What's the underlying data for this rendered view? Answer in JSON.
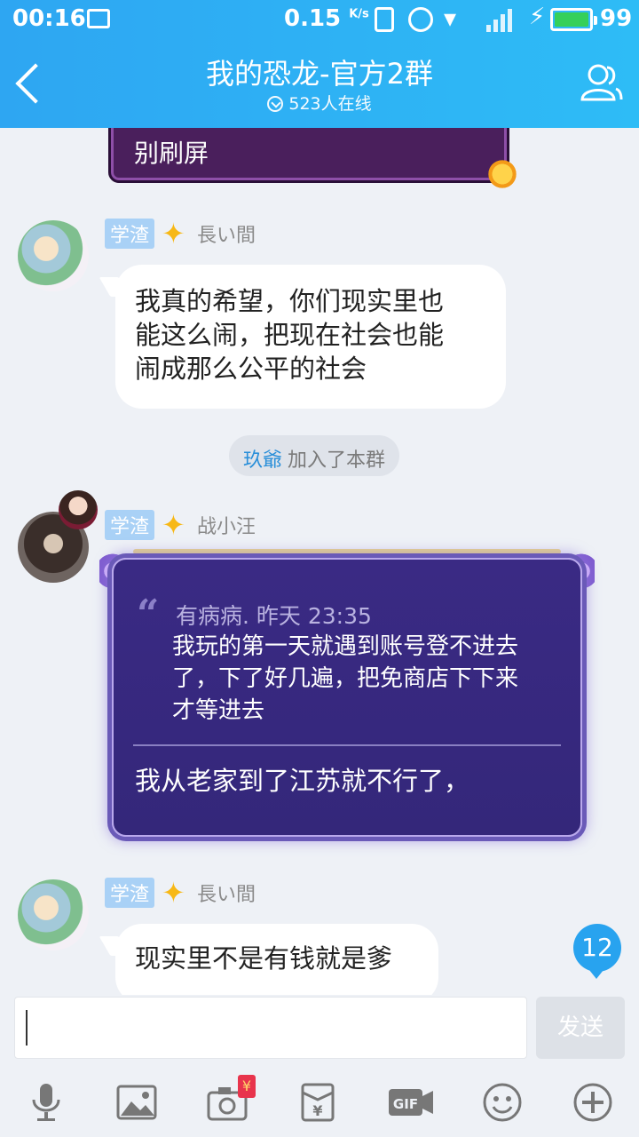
{
  "status_bar": {
    "time": "00:16",
    "net_speed": "0.15",
    "net_unit": "K/s",
    "network_type": "3G",
    "battery": "99"
  },
  "header": {
    "title": "我的恐龙-官方2群",
    "online": "523人在线"
  },
  "messages": [
    {
      "kind": "fancy",
      "text": "别刷屏"
    },
    {
      "kind": "text",
      "tag": "学渣",
      "name": "長い間",
      "text_lines": [
        "我真的希望，你们现实里也",
        "能这么闹，把现在社会也能",
        "闹成那么公平的社会"
      ]
    },
    {
      "kind": "system",
      "who": "玖爺",
      "text": "加入了本群"
    },
    {
      "kind": "quote",
      "tag": "学渣",
      "name": "战小汪",
      "quote_head": "有病病. 昨天 23:35",
      "quote_lines": [
        "我玩的第一天就遇到账号登不进去",
        "了，下了好几遍，把免商店下下来",
        "才等进去"
      ],
      "reply": "我从老家到了江苏就不行了，"
    },
    {
      "kind": "text",
      "tag": "学渣",
      "name": "長い間",
      "text_lines": [
        "现实里不是有钱就是爹"
      ]
    }
  ],
  "unread_count": "12",
  "input": {
    "value": "",
    "send_label": "发送"
  },
  "toolbar": {
    "icons": [
      "microphone-icon",
      "image-icon",
      "camera-icon",
      "red-packet-icon",
      "gif-icon",
      "emoji-icon",
      "plus-icon"
    ],
    "redpacket_symbol": "¥"
  },
  "colors": {
    "header": "#2ea6f2",
    "tag": "#a9d1f6",
    "badge": "#28a3ef",
    "quote_bg": "#3a2a84"
  }
}
